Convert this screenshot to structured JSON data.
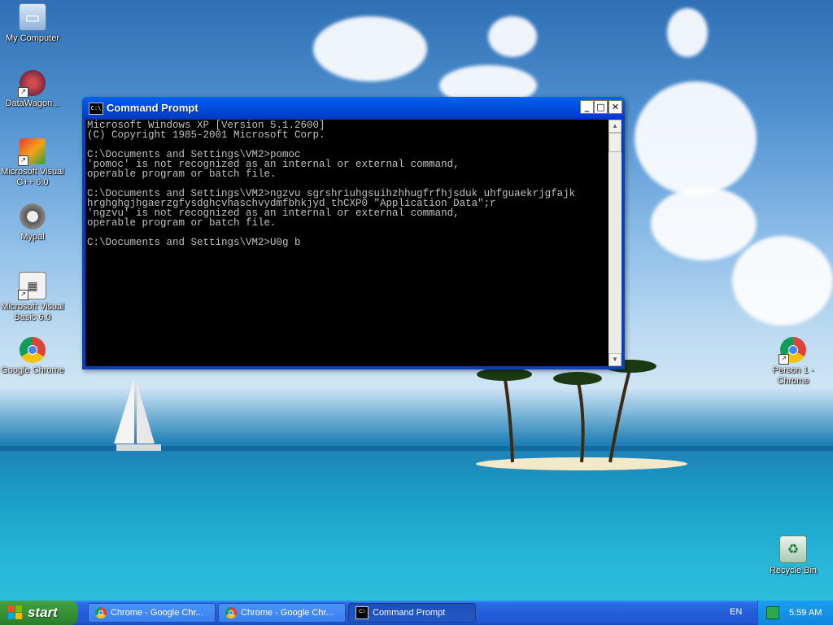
{
  "desktop": {
    "icons": [
      {
        "label": "My Computer",
        "icon": "my-computer-icon"
      },
      {
        "label": "DataWagon...",
        "icon": "datawagon-icon"
      },
      {
        "label": "Microsoft Visual C++ 6.0",
        "icon": "visual-cpp-icon"
      },
      {
        "label": "Mypal",
        "icon": "mypal-icon"
      },
      {
        "label": "Microsoft Visual Basic 6.0",
        "icon": "visual-basic-icon"
      },
      {
        "label": "Google Chrome",
        "icon": "chrome-icon"
      },
      {
        "label": "Person 1 - Chrome",
        "icon": "chrome-person-icon"
      },
      {
        "label": "Recycle Bin",
        "icon": "recycle-bin-icon"
      }
    ]
  },
  "window": {
    "title": "Command Prompt",
    "sys_icon_text": "C:\\",
    "buttons": {
      "minimize": "_",
      "maximize": "□",
      "close": "✕"
    },
    "console_text": "Microsoft Windows XP [Version 5.1.2600]\n(C) Copyright 1985-2001 Microsoft Corp.\n\nC:\\Documents and Settings\\VM2>pomoc\n'pomoc' is not recognized as an internal or external command,\noperable program or batch file.\n\nC:\\Documents and Settings\\VM2>ngzvu sgrshriuhgsuihzhhugfrfhjsduk uhfguaekrjgfajk\nhrghghgjhgaerzgfysdghcvhaschvydmfbhkjyd thCXP0 \"Application Data\";r\n'ngzvu' is not recognized as an internal or external command,\noperable program or batch file.\n\nC:\\Documents and Settings\\VM2>U0g b"
  },
  "taskbar": {
    "start_label": "start",
    "tasks": [
      {
        "label": "Chrome - Google Chr...",
        "icon": "chrome-icon"
      },
      {
        "label": "Chrome - Google Chr...",
        "icon": "chrome-icon"
      },
      {
        "label": "Command Prompt",
        "icon": "command-prompt-icon"
      }
    ],
    "language": "EN",
    "clock": "5:59 AM"
  }
}
